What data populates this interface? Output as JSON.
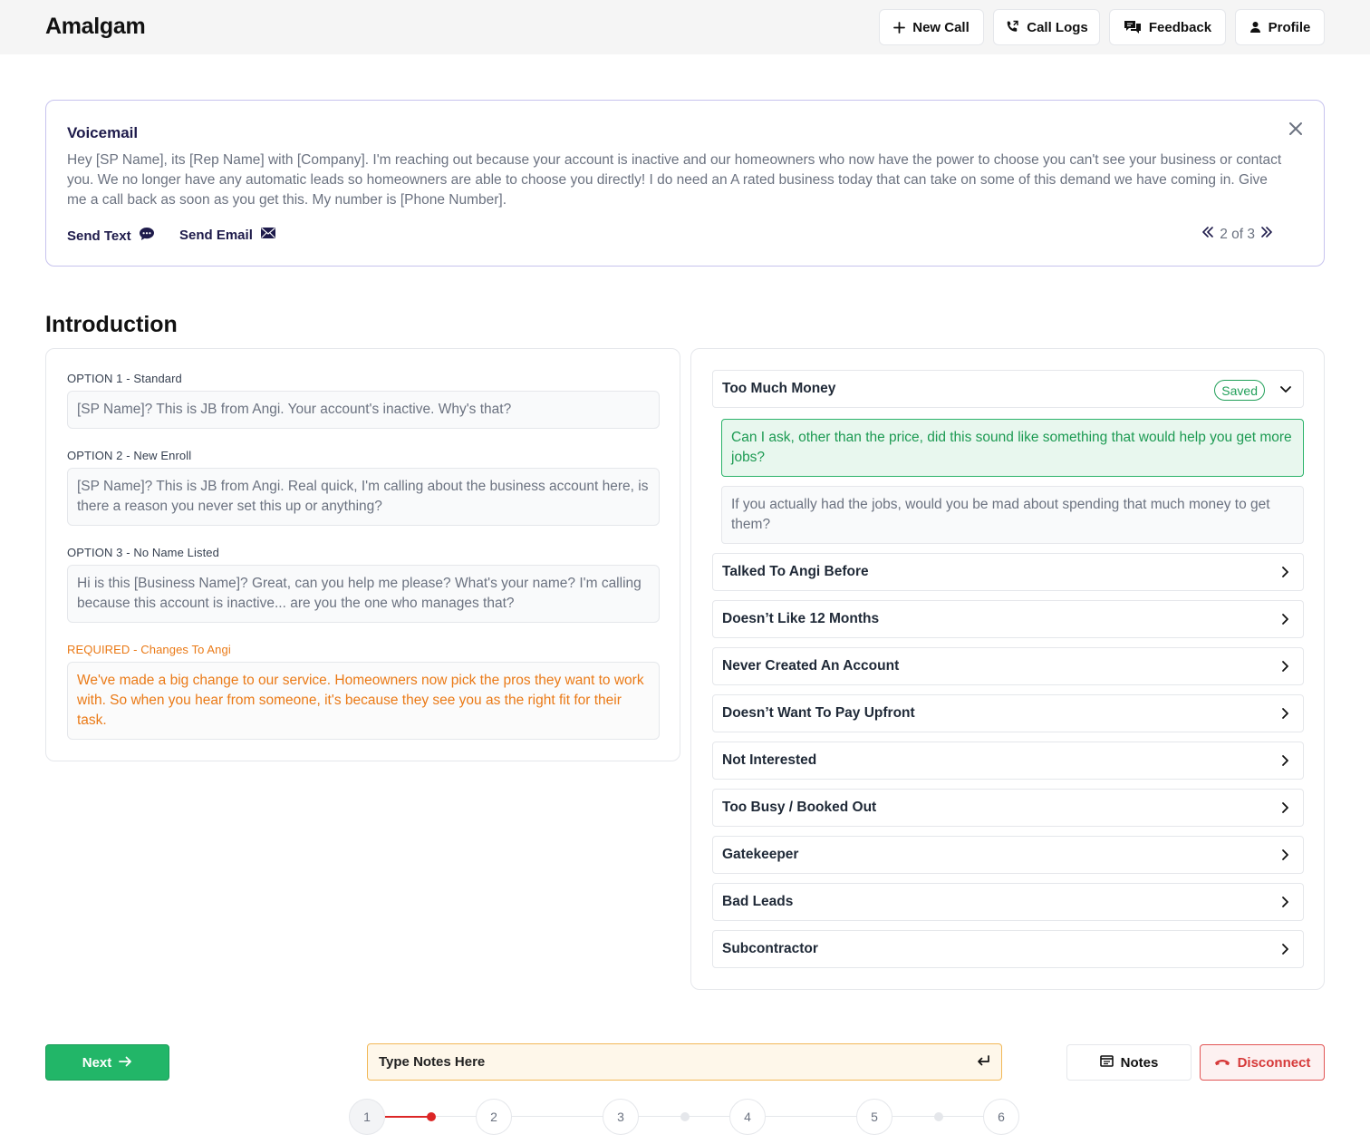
{
  "app": {
    "brand": "Amalgam"
  },
  "header": {
    "buttons": {
      "new_call": "New Call",
      "call_logs": "Call Logs",
      "feedback": "Feedback",
      "profile": "Profile"
    }
  },
  "voicemail": {
    "title": "Voicemail",
    "body": "Hey [SP Name], its [Rep Name] with [Company]. I'm reaching out because your account is inactive and our homeowners who now have the power to choose you can't see your business or contact you. We no longer have any automatic leads so homeowners are able to choose you directly! I do need an A rated business today that can take on some of this demand we have coming in. Give me a call back as soon as you get this. My number is [Phone Number].",
    "send_text": "Send Text",
    "send_email": "Send Email",
    "pager": "2 of 3"
  },
  "introduction": {
    "title": "Introduction",
    "options": [
      {
        "label": "OPTION 1 - Standard",
        "text": "[SP Name]? This is JB from Angi. Your account's inactive. Why's that?"
      },
      {
        "label": "OPTION 2 - New Enroll",
        "text": "[SP Name]? This is JB from Angi. Real quick, I'm calling about the business account here, is there a reason you never set this up or anything?"
      },
      {
        "label": "OPTION 3 - No Name Listed",
        "text": "Hi is this [Business Name]? Great, can you help me please? What's your name? I'm calling because this account is inactive... are you the one who manages that?"
      },
      {
        "label": "REQUIRED - Changes To Angi",
        "text": "We've made a big change to our service. Homeowners now pick the pros they want to work with. So when you hear from someone, it's because they see you as the right fit for their task."
      }
    ]
  },
  "objections": {
    "expanded": {
      "title": "Too Much Money",
      "badge": "Saved",
      "responses": [
        "Can I ask, other than the price, did this sound like something that would help you get more jobs?",
        "If you actually had the jobs, would you be mad about spending that much money to get them?"
      ]
    },
    "items": [
      "Talked To Angi Before",
      "Doesn’t Like 12 Months",
      "Never Created An Account",
      "Doesn’t Want To Pay Upfront",
      "Not Interested",
      "Too Busy / Booked Out",
      "Gatekeeper",
      "Bad Leads",
      "Subcontractor"
    ]
  },
  "footer": {
    "next": "Next",
    "notes_placeholder": "Type Notes Here",
    "notes_button": "Notes",
    "disconnect": "Disconnect"
  },
  "stepper": {
    "steps": [
      "1",
      "2",
      "3",
      "4",
      "5",
      "6"
    ],
    "current": "1"
  },
  "colors": {
    "primary_green": "#22b668",
    "danger_red": "#dc2626",
    "accent_orange": "#ea7a17",
    "voicemail_border": "#c7c3ee",
    "navy": "#1e1b4b"
  },
  "icons": {
    "new_call": "plus-icon",
    "call_logs": "phone-icon",
    "feedback": "chat-bubbles-icon",
    "profile": "user-icon",
    "close": "close-icon",
    "send_text": "chat-icon",
    "send_email": "envelope-icon",
    "pager_prev": "double-chevron-left-icon",
    "pager_next": "double-chevron-right-icon",
    "collapse": "chevron-down-icon",
    "expand": "chevron-right-icon",
    "next": "arrow-right-icon",
    "enter": "enter-icon",
    "notes": "notes-icon",
    "disconnect": "phone-hangup-icon"
  }
}
